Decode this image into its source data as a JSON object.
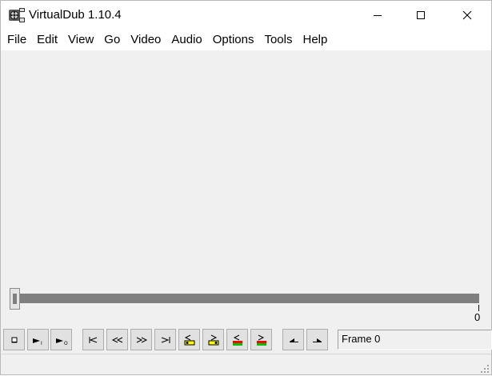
{
  "window": {
    "title": "VirtualDub 1.10.4",
    "icon": "film-reel-icon"
  },
  "titlebar_buttons": {
    "minimize": "minimize-icon",
    "maximize": "maximize-icon",
    "close": "close-icon"
  },
  "menu": {
    "items": [
      {
        "label": "File"
      },
      {
        "label": "Edit"
      },
      {
        "label": "View"
      },
      {
        "label": "Go"
      },
      {
        "label": "Video"
      },
      {
        "label": "Audio"
      },
      {
        "label": "Options"
      },
      {
        "label": "Tools"
      },
      {
        "label": "Help"
      }
    ]
  },
  "timeline": {
    "position_label": "0",
    "position": 0
  },
  "toolbar": {
    "buttons": [
      {
        "name": "stop",
        "icon": "stop-icon"
      },
      {
        "name": "play-input",
        "icon": "play-input-icon"
      },
      {
        "name": "play-output",
        "icon": "play-output-icon"
      },
      {
        "name": "go-start",
        "icon": "go-to-start-icon"
      },
      {
        "name": "step-back",
        "icon": "step-back-icon"
      },
      {
        "name": "step-forward",
        "icon": "step-forward-icon"
      },
      {
        "name": "go-end",
        "icon": "go-to-end-icon"
      },
      {
        "name": "prev-keyframe",
        "icon": "prev-keyframe-icon"
      },
      {
        "name": "next-keyframe",
        "icon": "next-keyframe-icon"
      },
      {
        "name": "prev-scene",
        "icon": "prev-scene-icon"
      },
      {
        "name": "next-scene",
        "icon": "next-scene-icon"
      },
      {
        "name": "mark-in",
        "icon": "mark-in-icon"
      },
      {
        "name": "mark-out",
        "icon": "mark-out-icon"
      }
    ]
  },
  "frame_display": {
    "text": "Frame 0"
  },
  "colors": {
    "window_bg": "#f0f0f0",
    "track": "#7f7f7f",
    "keyframe_yellow": "#ffff00",
    "scene_red": "#ff0000",
    "scene_green": "#00c000"
  }
}
